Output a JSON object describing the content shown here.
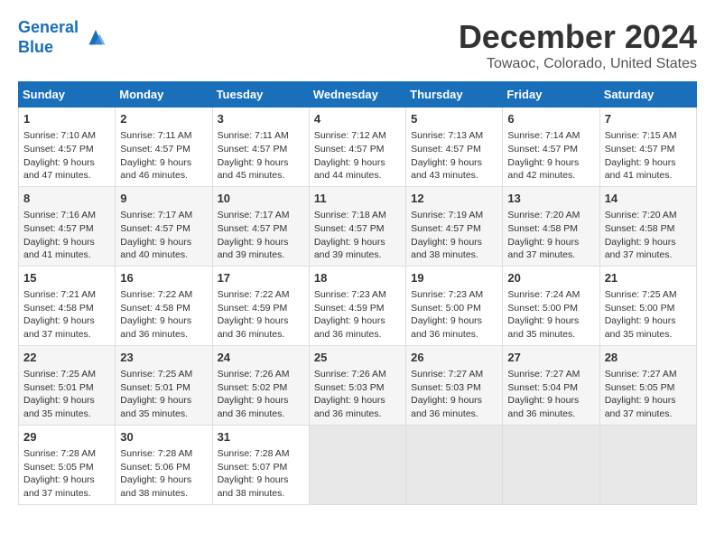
{
  "header": {
    "logo_line1": "General",
    "logo_line2": "Blue",
    "title": "December 2024",
    "subtitle": "Towaoc, Colorado, United States"
  },
  "days_of_week": [
    "Sunday",
    "Monday",
    "Tuesday",
    "Wednesday",
    "Thursday",
    "Friday",
    "Saturday"
  ],
  "weeks": [
    [
      {
        "day": "1",
        "info": "Sunrise: 7:10 AM\nSunset: 4:57 PM\nDaylight: 9 hours and 47 minutes."
      },
      {
        "day": "2",
        "info": "Sunrise: 7:11 AM\nSunset: 4:57 PM\nDaylight: 9 hours and 46 minutes."
      },
      {
        "day": "3",
        "info": "Sunrise: 7:11 AM\nSunset: 4:57 PM\nDaylight: 9 hours and 45 minutes."
      },
      {
        "day": "4",
        "info": "Sunrise: 7:12 AM\nSunset: 4:57 PM\nDaylight: 9 hours and 44 minutes."
      },
      {
        "day": "5",
        "info": "Sunrise: 7:13 AM\nSunset: 4:57 PM\nDaylight: 9 hours and 43 minutes."
      },
      {
        "day": "6",
        "info": "Sunrise: 7:14 AM\nSunset: 4:57 PM\nDaylight: 9 hours and 42 minutes."
      },
      {
        "day": "7",
        "info": "Sunrise: 7:15 AM\nSunset: 4:57 PM\nDaylight: 9 hours and 41 minutes."
      }
    ],
    [
      {
        "day": "8",
        "info": "Sunrise: 7:16 AM\nSunset: 4:57 PM\nDaylight: 9 hours and 41 minutes."
      },
      {
        "day": "9",
        "info": "Sunrise: 7:17 AM\nSunset: 4:57 PM\nDaylight: 9 hours and 40 minutes."
      },
      {
        "day": "10",
        "info": "Sunrise: 7:17 AM\nSunset: 4:57 PM\nDaylight: 9 hours and 39 minutes."
      },
      {
        "day": "11",
        "info": "Sunrise: 7:18 AM\nSunset: 4:57 PM\nDaylight: 9 hours and 39 minutes."
      },
      {
        "day": "12",
        "info": "Sunrise: 7:19 AM\nSunset: 4:57 PM\nDaylight: 9 hours and 38 minutes."
      },
      {
        "day": "13",
        "info": "Sunrise: 7:20 AM\nSunset: 4:58 PM\nDaylight: 9 hours and 37 minutes."
      },
      {
        "day": "14",
        "info": "Sunrise: 7:20 AM\nSunset: 4:58 PM\nDaylight: 9 hours and 37 minutes."
      }
    ],
    [
      {
        "day": "15",
        "info": "Sunrise: 7:21 AM\nSunset: 4:58 PM\nDaylight: 9 hours and 37 minutes."
      },
      {
        "day": "16",
        "info": "Sunrise: 7:22 AM\nSunset: 4:58 PM\nDaylight: 9 hours and 36 minutes."
      },
      {
        "day": "17",
        "info": "Sunrise: 7:22 AM\nSunset: 4:59 PM\nDaylight: 9 hours and 36 minutes."
      },
      {
        "day": "18",
        "info": "Sunrise: 7:23 AM\nSunset: 4:59 PM\nDaylight: 9 hours and 36 minutes."
      },
      {
        "day": "19",
        "info": "Sunrise: 7:23 AM\nSunset: 5:00 PM\nDaylight: 9 hours and 36 minutes."
      },
      {
        "day": "20",
        "info": "Sunrise: 7:24 AM\nSunset: 5:00 PM\nDaylight: 9 hours and 35 minutes."
      },
      {
        "day": "21",
        "info": "Sunrise: 7:25 AM\nSunset: 5:00 PM\nDaylight: 9 hours and 35 minutes."
      }
    ],
    [
      {
        "day": "22",
        "info": "Sunrise: 7:25 AM\nSunset: 5:01 PM\nDaylight: 9 hours and 35 minutes."
      },
      {
        "day": "23",
        "info": "Sunrise: 7:25 AM\nSunset: 5:01 PM\nDaylight: 9 hours and 35 minutes."
      },
      {
        "day": "24",
        "info": "Sunrise: 7:26 AM\nSunset: 5:02 PM\nDaylight: 9 hours and 36 minutes."
      },
      {
        "day": "25",
        "info": "Sunrise: 7:26 AM\nSunset: 5:03 PM\nDaylight: 9 hours and 36 minutes."
      },
      {
        "day": "26",
        "info": "Sunrise: 7:27 AM\nSunset: 5:03 PM\nDaylight: 9 hours and 36 minutes."
      },
      {
        "day": "27",
        "info": "Sunrise: 7:27 AM\nSunset: 5:04 PM\nDaylight: 9 hours and 36 minutes."
      },
      {
        "day": "28",
        "info": "Sunrise: 7:27 AM\nSunset: 5:05 PM\nDaylight: 9 hours and 37 minutes."
      }
    ],
    [
      {
        "day": "29",
        "info": "Sunrise: 7:28 AM\nSunset: 5:05 PM\nDaylight: 9 hours and 37 minutes."
      },
      {
        "day": "30",
        "info": "Sunrise: 7:28 AM\nSunset: 5:06 PM\nDaylight: 9 hours and 38 minutes."
      },
      {
        "day": "31",
        "info": "Sunrise: 7:28 AM\nSunset: 5:07 PM\nDaylight: 9 hours and 38 minutes."
      },
      {
        "day": "",
        "info": ""
      },
      {
        "day": "",
        "info": ""
      },
      {
        "day": "",
        "info": ""
      },
      {
        "day": "",
        "info": ""
      }
    ]
  ]
}
